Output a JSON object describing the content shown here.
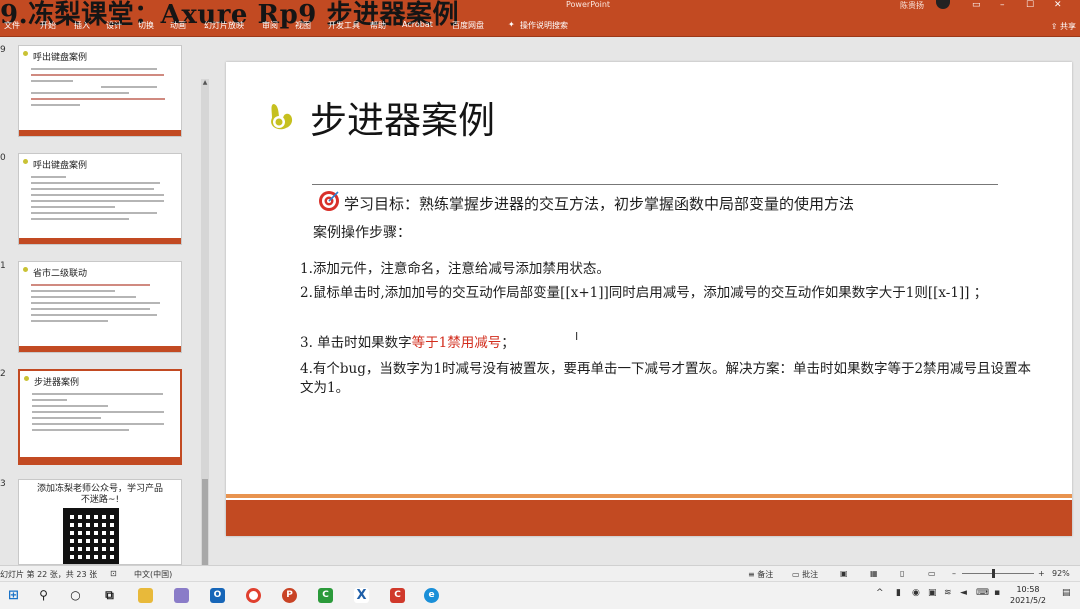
{
  "window": {
    "overlay_title": "9.冻梨课堂：Axure Rp9 步进器案例",
    "app_name": "PowerPoint",
    "user_name": "陈贵扬",
    "share_label": "共享",
    "ribbon_tabs": [
      "文件",
      "开始",
      "插入",
      "设计",
      "切换",
      "动画",
      "幻灯片放映",
      "审阅",
      "视图",
      "开发工具",
      "帮助",
      "Acrobat",
      "百度网盘",
      "操作说明搜索"
    ]
  },
  "thumbnails": [
    {
      "number": "9",
      "title": "呼出键盘案例"
    },
    {
      "number": "0",
      "title": "呼出键盘案例"
    },
    {
      "number": "1",
      "title": "省市二级联动"
    },
    {
      "number": "2",
      "title": "步进器案例"
    },
    {
      "number": "3",
      "title": "添加冻梨老师公众号，学习产品不迷路~!"
    }
  ],
  "slide": {
    "title": "步进器案例",
    "goal": "学习目标：熟练掌握步进器的交互方法，初步掌握函数中局部变量的使用方法",
    "steps_heading": "案例操作步骤：",
    "step1": "1.添加元件，注意命名，注意给减号添加禁用状态。",
    "step2": "2.鼠标单击时,添加加号的交互动作局部变量[[x+1]]同时启用减号，添加减号的交互动作如果数字大于1则[[x-1]] ；",
    "step3_prefix": "3.  单击时如果数字",
    "step3_highlight": "等于1禁用减号",
    "step3_suffix": "；",
    "step4": "4.有个bug，当数字为1时减号没有被置灰，要再单击一下减号才置灰。解决方案：单击时如果数字等于2禁用减号且设置本文为1。",
    "accent_color": "#c24a22",
    "highlight_color": "#d22d1d"
  },
  "statusbar": {
    "slide_info": "幻灯片 第 22 张，共 23 张",
    "language": "中文(中国)",
    "notes_label": "备注",
    "comments_label": "批注",
    "zoom": "92%"
  },
  "taskbar": {
    "time": "10:58",
    "date": "2021/5/2"
  }
}
